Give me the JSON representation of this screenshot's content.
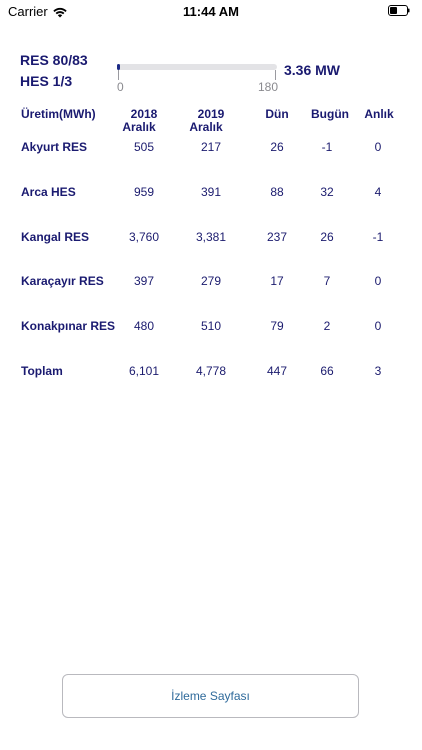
{
  "status_bar": {
    "carrier": "Carrier",
    "time": "11:44 AM"
  },
  "header": {
    "line1": "RES 80/83",
    "line2": "HES 1/3",
    "gauge": {
      "min_label": "0",
      "max_label": "180",
      "value_fraction": 0.0187
    },
    "power": "3.36 MW"
  },
  "table": {
    "headers": {
      "label": "Üretim(MWh)",
      "col1_line1": "2018",
      "col1_line2": "Aralık",
      "col2_line1": "2019",
      "col2_line2": "Aralık",
      "col3": "Dün",
      "col4": "Bugün",
      "col5": "Anlık"
    },
    "rows": [
      {
        "name": "Akyurt RES",
        "v2018": "505",
        "v2019": "217",
        "dun": "26",
        "bugun": "-1",
        "anlik": "0"
      },
      {
        "name": "Arca HES",
        "v2018": "959",
        "v2019": "391",
        "dun": "88",
        "bugun": "32",
        "anlik": "4"
      },
      {
        "name": "Kangal RES",
        "v2018": "3,760",
        "v2019": "3,381",
        "dun": "237",
        "bugun": "26",
        "anlik": "-1"
      },
      {
        "name": "Karaçayır RES",
        "v2018": "397",
        "v2019": "279",
        "dun": "17",
        "bugun": "7",
        "anlik": "0"
      },
      {
        "name": "Konakpınar RES",
        "v2018": "480",
        "v2019": "510",
        "dun": "79",
        "bugun": "2",
        "anlik": "0"
      },
      {
        "name": "Toplam",
        "v2018": "6,101",
        "v2019": "4,778",
        "dun": "447",
        "bugun": "66",
        "anlik": "3"
      }
    ]
  },
  "button": {
    "label": "İzleme Sayfası"
  },
  "colors": {
    "text_primary": "#1a1a70",
    "gauge_fill": "#1c2a86",
    "gauge_track": "#e3e3e6",
    "button_text": "#2f6a9b"
  }
}
